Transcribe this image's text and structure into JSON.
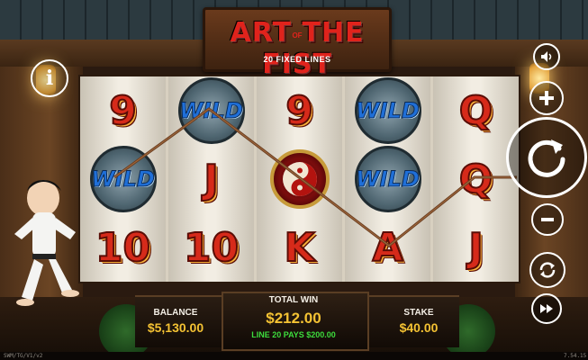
{
  "game": {
    "logo": {
      "title": "ART THE FIST",
      "of": "OF",
      "subtitle": "20 FIXED LINES"
    },
    "reels": [
      [
        "9",
        "WILD",
        "10"
      ],
      [
        "WILD",
        "J",
        "10"
      ],
      [
        "9",
        "YINYANG",
        "K"
      ],
      [
        "WILD",
        "WILD",
        "A"
      ],
      [
        "Q",
        "Q",
        "J"
      ]
    ],
    "panel": {
      "balance_label": "BALANCE",
      "balance_value": "$5,130.00",
      "total_win_label": "TOTAL WIN",
      "total_win_value": "$212.00",
      "line_win_text": "LINE 20 PAYS $200.00",
      "stake_label": "STAKE",
      "stake_value": "$40.00"
    },
    "controls": {
      "info": "i",
      "sound": "speaker-icon",
      "plus": "plus-icon",
      "spin": "spin-icon",
      "minus": "minus-icon",
      "autoplay": "autoplay-icon",
      "turbo": "fast-forward-icon"
    },
    "footer": {
      "left": "SWM/TG/V1/v2",
      "right": "7.54.15"
    },
    "colors": {
      "accent_gold": "#f4c233",
      "line_win_green": "#3ddc3d",
      "symbol_red": "#d62a1a"
    }
  }
}
